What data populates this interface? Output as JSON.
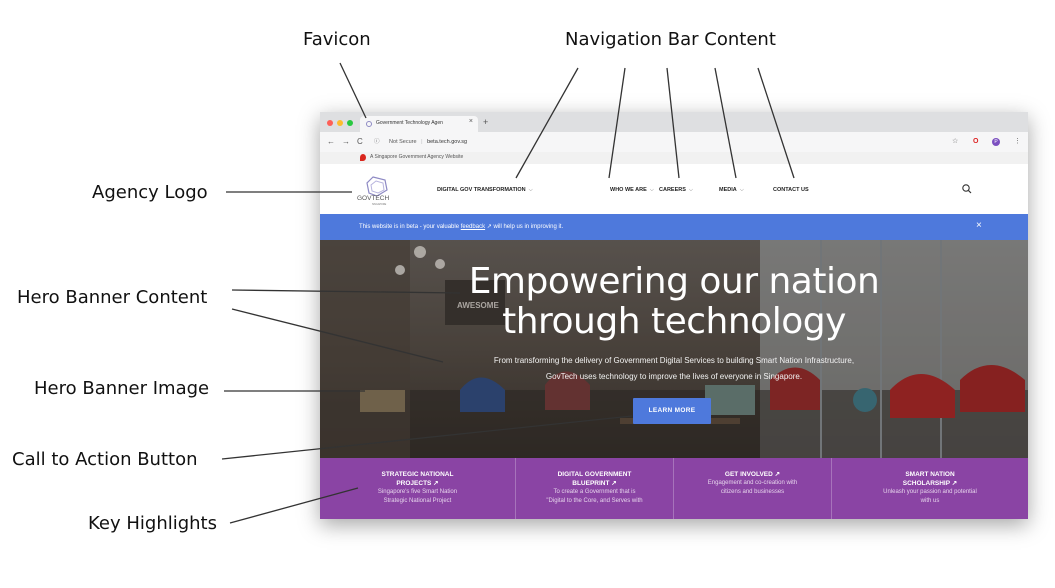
{
  "annotations": {
    "favicon": "Favicon",
    "navigation_bar_content": "Navigation Bar Content",
    "agency_logo": "Agency Logo",
    "hero_banner_content": "Hero Banner Content",
    "hero_banner_image": "Hero Banner Image",
    "call_to_action_button": "Call to Action Button",
    "key_highlights": "Key Highlights"
  },
  "browser": {
    "tab_title": "Government Technology Agen",
    "tab_close": "×",
    "new_tab": "+",
    "back": "←",
    "forward": "→",
    "reload": "C",
    "security_label": "Not Secure",
    "url": "beta.tech.gov.sg",
    "extension_avatar": "P"
  },
  "gov_banner": {
    "text": "A Singapore Government Agency Website"
  },
  "site": {
    "logo_text": "GOVTECH",
    "logo_subtext": "SINGAPORE",
    "nav": [
      {
        "label": "DIGITAL GOV TRANSFORMATION",
        "has_dropdown": true
      },
      {
        "label": "WHO WE ARE",
        "has_dropdown": true
      },
      {
        "label": "CAREERS",
        "has_dropdown": true
      },
      {
        "label": "MEDIA",
        "has_dropdown": true
      },
      {
        "label": "CONTACT US",
        "has_dropdown": false
      }
    ],
    "caret": "⌵",
    "search_icon": "search-icon"
  },
  "beta_notice": {
    "before": "This website is in beta - your valuable ",
    "link": "feedback",
    "after": " ↗ will help us in improving it.",
    "close": "×"
  },
  "hero": {
    "title_line1": "Empowering our nation",
    "title_line2": "through technology",
    "subtitle_line1": "From transforming the delivery of Government Digital Services to building Smart Nation Infrastructure,",
    "subtitle_line2": "GovTech uses technology to improve the lives of everyone in Singapore.",
    "cta_label": "LEARN MORE",
    "sign_text": "AWESOME"
  },
  "highlights": [
    {
      "title_line1": "STRATEGIC NATIONAL",
      "title_line2": "PROJECTS ↗",
      "desc_line1": "Singapore's five Smart Nation",
      "desc_line2": "Strategic National Project"
    },
    {
      "title_line1": "DIGITAL GOVERNMENT",
      "title_line2": "BLUEPRINT ↗",
      "desc_line1": "To create a Government that is",
      "desc_line2": "\"Digital to the Core, and Serves with"
    },
    {
      "title_line1": "GET INVOLVED ↗",
      "title_line2": "",
      "desc_line1": "Engagement and co-creation with",
      "desc_line2": "citizens and businesses"
    },
    {
      "title_line1": "SMART NATION",
      "title_line2": "SCHOLARSHIP ↗",
      "desc_line1": "Unleash your passion and potential",
      "desc_line2": "with us"
    }
  ],
  "colors": {
    "accent_blue": "#4e79dc",
    "highlight_purple": "#8a44a4",
    "favicon_purple": "#8e8ac4"
  }
}
